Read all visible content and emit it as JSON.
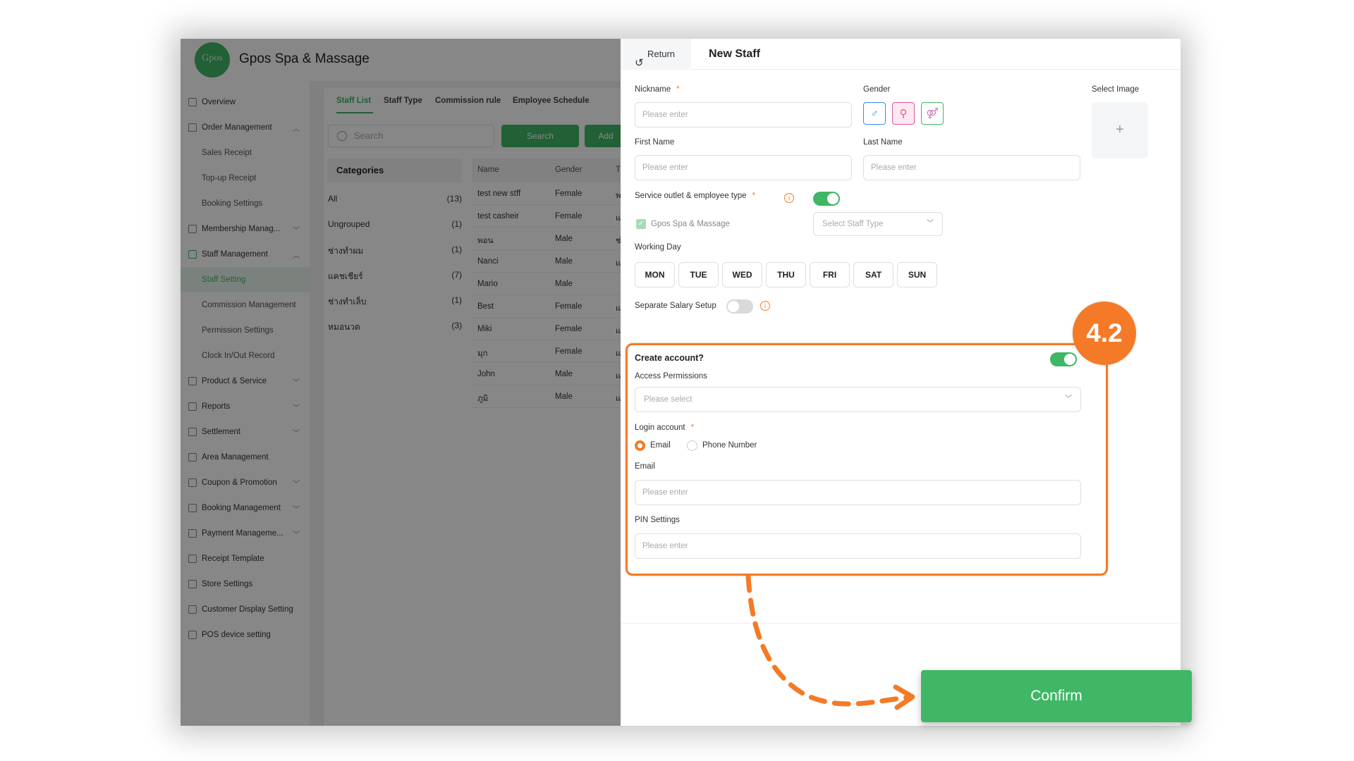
{
  "app": {
    "logo_text": "Gpos",
    "store_name": "Gpos Spa & Massage"
  },
  "sidebar": {
    "items": [
      {
        "label": "Overview"
      },
      {
        "label": "Order Management"
      },
      {
        "label": "Sales Receipt"
      },
      {
        "label": "Top-up Receipt"
      },
      {
        "label": "Booking Settings"
      },
      {
        "label": "Membership Manag..."
      },
      {
        "label": "Staff Management"
      },
      {
        "label": "Staff Setting"
      },
      {
        "label": "Commission Management"
      },
      {
        "label": "Permission Settings"
      },
      {
        "label": "Clock In/Out Record"
      },
      {
        "label": "Product & Service"
      },
      {
        "label": "Reports"
      },
      {
        "label": "Settlement"
      },
      {
        "label": "Area Management"
      },
      {
        "label": "Coupon & Promotion"
      },
      {
        "label": "Booking Management"
      },
      {
        "label": "Payment Manageme..."
      },
      {
        "label": "Receipt Template"
      },
      {
        "label": "Store Settings"
      },
      {
        "label": "Customer Display Setting"
      },
      {
        "label": "POS device setting"
      }
    ]
  },
  "staff_page": {
    "tabs": [
      "Staff List",
      "Staff Type",
      "Commission rule",
      "Employee Schedule"
    ],
    "search_placeholder": "Search",
    "search_button": "Search",
    "add_button": "Add",
    "categories_title": "Categories",
    "categories": [
      {
        "name": "All",
        "count": "(13)"
      },
      {
        "name": "Ungrouped",
        "count": "(1)"
      },
      {
        "name": "ช่างทำผม",
        "count": "(1)"
      },
      {
        "name": "แคชเชียร์",
        "count": "(7)"
      },
      {
        "name": "ช่างทำเล็บ",
        "count": "(1)"
      },
      {
        "name": "หมอนวด",
        "count": "(3)"
      }
    ],
    "columns": [
      "Name",
      "Gender",
      "T"
    ],
    "rows": [
      {
        "name": "test new stff",
        "gender": "Female",
        "t": "พ"
      },
      {
        "name": "test casheir",
        "gender": "Female",
        "t": "แ"
      },
      {
        "name": "พอน",
        "gender": "Male",
        "t": "ช่"
      },
      {
        "name": "Nanci",
        "gender": "Male",
        "t": "แ"
      },
      {
        "name": "Mario",
        "gender": "Male",
        "t": ""
      },
      {
        "name": "Best",
        "gender": "Female",
        "t": "แ"
      },
      {
        "name": "Miki",
        "gender": "Female",
        "t": "แ"
      },
      {
        "name": "มุก",
        "gender": "Female",
        "t": "แ"
      },
      {
        "name": "John",
        "gender": "Male",
        "t": "แ"
      },
      {
        "name": "ภูมิ",
        "gender": "Male",
        "t": "แ"
      }
    ]
  },
  "drawer": {
    "return_label": "Return",
    "title": "New Staff",
    "nickname_label": "Nickname",
    "required_mark": "*",
    "nickname_placeholder": "Please enter",
    "gender_label": "Gender",
    "select_image_label": "Select Image",
    "image_plus": "+",
    "first_name_label": "First Name",
    "first_name_placeholder": "Please enter",
    "last_name_label": "Last Name",
    "last_name_placeholder": "Please enter",
    "service_outlet_label": "Service outlet & employee type",
    "outlet_name": "Gpos Spa & Massage",
    "staff_type_placeholder": "Select Staff Type",
    "working_day_label": "Working Day",
    "days": [
      "MON",
      "TUE",
      "WED",
      "THU",
      "FRI",
      "SAT",
      "SUN"
    ],
    "separate_salary_label": "Separate Salary Setup",
    "create_account_label": "Create account?",
    "access_permissions_label": "Access Permissions",
    "access_permissions_placeholder": "Please select",
    "login_account_label": "Login account",
    "login_options": [
      "Email",
      "Phone Number"
    ],
    "login_selected": "Email",
    "email_label": "Email",
    "email_placeholder": "Please enter",
    "pin_label": "PIN Settings",
    "pin_placeholder": "Please enter",
    "toggles": {
      "service_outlet": true,
      "separate_salary": false,
      "create_account": true
    }
  },
  "annotation": {
    "step_badge": "4.2",
    "confirm_label": "Confirm"
  },
  "colors": {
    "accent_green": "#3fb765",
    "highlight_orange": "#f47a27"
  }
}
